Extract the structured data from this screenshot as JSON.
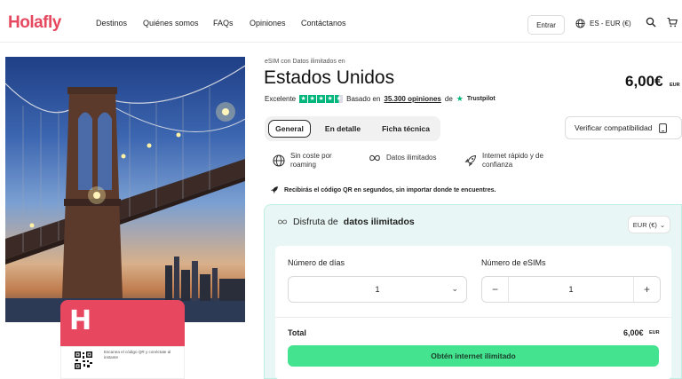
{
  "brand": {
    "name": "Holafly",
    "color": "#e6485f"
  },
  "nav": {
    "links": [
      "Destinos",
      "Quiénes somos",
      "FAQs",
      "Opiniones",
      "Contáctanos"
    ],
    "login_label": "Entrar",
    "language_currency": "ES - EUR (€)",
    "icons": [
      "globe-icon",
      "search-icon",
      "cart-icon"
    ]
  },
  "card": {
    "letter": "H",
    "caption": "Escanea el código QR y conéctate al instante"
  },
  "product": {
    "eyebrow": "eSIM con Datos ilimitados en",
    "title": "Estados Unidos",
    "price": "6,00€",
    "price_currency": "EUR",
    "rating": {
      "label": "Excelente",
      "stars": 4.5,
      "based_on": "Basado en",
      "reviews_link": "35.300 opiniones",
      "connector": "de",
      "provider": "Trustpilot"
    }
  },
  "tabs": [
    {
      "label": "General",
      "active": true
    },
    {
      "label": "En detalle",
      "active": false
    },
    {
      "label": "Ficha técnica",
      "active": false
    }
  ],
  "verify_label": "Verificar compatibilidad",
  "features": [
    {
      "icon": "globe-icon",
      "line1": "Sin coste por",
      "line2": "roaming"
    },
    {
      "icon": "infinity-icon",
      "line1": "Datos ilimitados",
      "line2": ""
    },
    {
      "icon": "rocket-icon",
      "line1": "Internet rápido y de",
      "line2": "confianza"
    }
  ],
  "qr_note": "Recibirás el código QR en segundos, sin importar donde te encuentres.",
  "plan": {
    "title_prefix": "Disfruta de",
    "title_bold": "datos ilimitados",
    "currency_select": "EUR (€)",
    "days_label": "Número de días",
    "days_value": "1",
    "esims_label": "Número de eSIMs",
    "esims_value": "1",
    "minus": "−",
    "plus": "+",
    "total_label": "Total",
    "total_value": "6,00€",
    "total_currency": "EUR",
    "cta_label": "Obtén internet ilimitado",
    "accent": "#44e38f"
  }
}
